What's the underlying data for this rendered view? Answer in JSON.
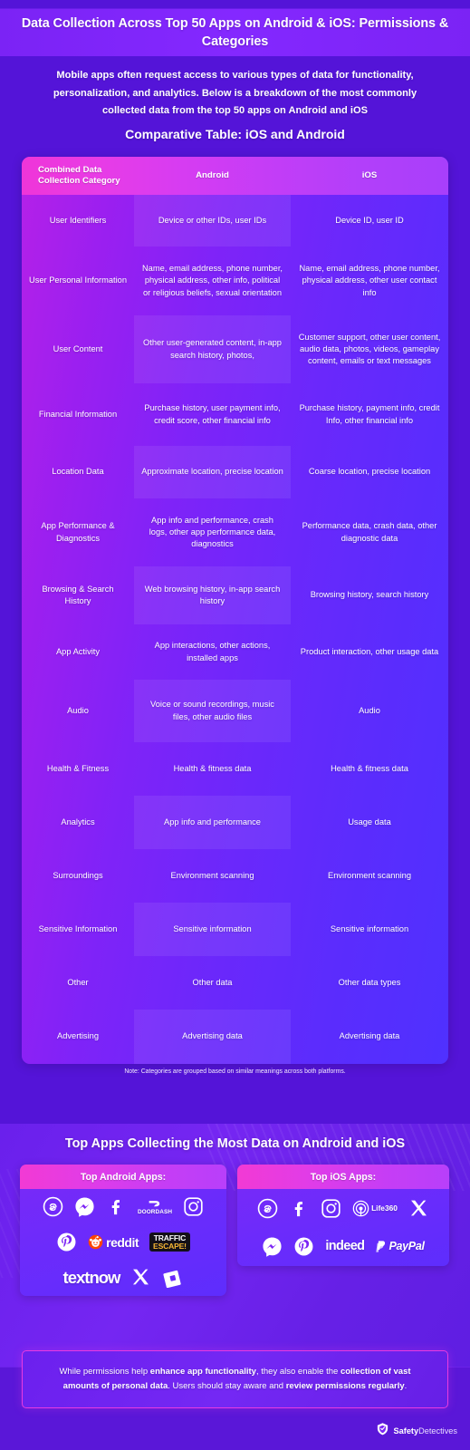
{
  "header": {
    "title": "Data Collection Across Top 50 Apps on Android & iOS: Permissions & Categories",
    "intro": "Mobile apps often request access to various types of data for functionality, personalization, and analytics. Below is a breakdown of the most commonly collected data from the top 50 apps on Android and iOS",
    "section_heading": "Comparative Table: iOS and Android"
  },
  "table": {
    "columns": [
      "Combined Data Collection Category",
      "Android",
      "iOS"
    ],
    "rows": [
      {
        "category": "User Identifiers",
        "android": "Device or other IDs, user IDs",
        "ios": "Device ID, user ID"
      },
      {
        "category": "User Personal Information",
        "android": "Name, email address, phone number, physical address, other info, political or religious beliefs, sexual orientation",
        "ios": "Name, email address, phone number, physical address, other user contact info"
      },
      {
        "category": "User Content",
        "android": "Other user-generated content, in-app search history, photos,",
        "ios": "Customer support, other user content, audio data, photos, videos, gameplay content, emails or text messages"
      },
      {
        "category": "Financial Information",
        "android": "Purchase history, user payment info, credit score, other financial info",
        "ios": "Purchase history, payment info, credit Info, other financial info"
      },
      {
        "category": "Location Data",
        "android": "Approximate location, precise location",
        "ios": "Coarse location, precise location"
      },
      {
        "category": "App Performance & Diagnostics",
        "android": "App info and performance, crash logs, other app performance data, diagnostics",
        "ios": "Performance data, crash data, other diagnostic data"
      },
      {
        "category": "Browsing & Search History",
        "android": "Web browsing history, in-app search history",
        "ios": "Browsing history, search history"
      },
      {
        "category": "App Activity",
        "android": "App interactions, other actions, installed apps",
        "ios": "Product interaction, other usage data"
      },
      {
        "category": "Audio",
        "android": "Voice or sound recordings, music files, other audio files",
        "ios": "Audio"
      },
      {
        "category": "Health & Fitness",
        "android": "Health & fitness data",
        "ios": "Health & fitness data"
      },
      {
        "category": "Analytics",
        "android": "App info and performance",
        "ios": "Usage data"
      },
      {
        "category": "Surroundings",
        "android": "Environment scanning",
        "ios": "Environment scanning"
      },
      {
        "category": "Sensitive Information",
        "android": "Sensitive information",
        "ios": "Sensitive information"
      },
      {
        "category": "Other",
        "android": "Other data",
        "ios": "Other data types"
      },
      {
        "category": "Advertising",
        "android": "Advertising data",
        "ios": "Advertising data"
      }
    ],
    "note": "Note: Categories are grouped based on similar meanings across both platforms."
  },
  "apps": {
    "title": "Top Apps Collecting the Most Data on Android and iOS",
    "android_panel": {
      "heading": "Top Android Apps:",
      "rows": [
        [
          "Threads",
          "Messenger",
          "Facebook",
          "DoorDash",
          "Instagram"
        ],
        [
          "Pinterest",
          "reddit",
          "Traffic Escape!"
        ],
        [
          "TextNow",
          "X",
          "Roblox"
        ]
      ]
    },
    "ios_panel": {
      "heading": "Top iOS Apps:",
      "rows": [
        [
          "Threads",
          "Facebook",
          "Instagram",
          "Life360",
          "X"
        ],
        [
          "Messenger",
          "Pinterest",
          "indeed",
          "PayPal"
        ]
      ]
    }
  },
  "callout": {
    "part1": "While permissions help ",
    "bold1": "enhance app functionality",
    "part2": ", they also enable the ",
    "bold2": "collection of vast amounts of personal data",
    "part3": ". Users should stay aware and ",
    "bold3": "review permissions regularly",
    "part4": "."
  },
  "brand": {
    "strong": "Safety",
    "light": "Detectives"
  },
  "colors": {
    "background": "#5414d8",
    "title_band": "#7b23f5",
    "table_header_magenta": "#ef35d8",
    "table_gradient_start": "#b521e8",
    "table_gradient_end": "#4f31ff",
    "callout_border": "#e93ae0"
  }
}
